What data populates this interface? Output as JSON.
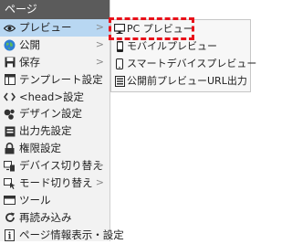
{
  "menu": {
    "title": "ページ",
    "items": [
      {
        "label": "プレビュー",
        "arrow": ">"
      },
      {
        "label": "公開",
        "arrow": ">"
      },
      {
        "label": "保存",
        "arrow": ">"
      },
      {
        "label": "テンプレート設定"
      },
      {
        "label": "<head>設定"
      },
      {
        "label": "デザイン設定"
      },
      {
        "label": "出力先設定"
      },
      {
        "label": "権限設定"
      },
      {
        "label": "デバイス切り替え",
        "arrow": ">"
      },
      {
        "label": "モード切り替え",
        "arrow": ">"
      },
      {
        "label": "ツール"
      },
      {
        "label": "再読み込み"
      },
      {
        "label": "ページ情報表示・設定"
      }
    ]
  },
  "submenu": {
    "items": [
      {
        "label": "PC プレビュー"
      },
      {
        "label": "モバイルプレビュー"
      },
      {
        "label": "スマートデバイスプレビュー"
      },
      {
        "label": "公開前プレビューURL出力"
      }
    ]
  },
  "colors": {
    "title_bar": "#5b5b5b",
    "active_item": "#b8d7f2",
    "highlight": "#e8111a"
  }
}
